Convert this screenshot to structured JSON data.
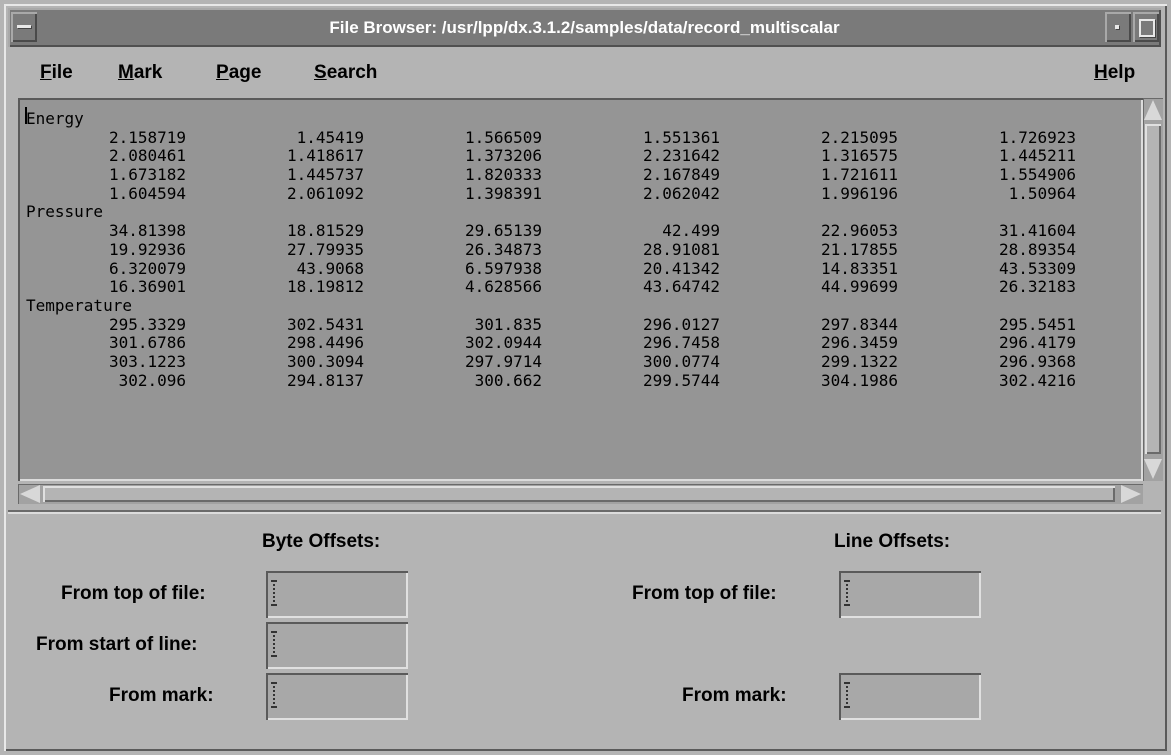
{
  "window": {
    "title": "File Browser: /usr/lpp/dx.3.1.2/samples/data/record_multiscalar"
  },
  "menu": {
    "file": "File",
    "mark": "Mark",
    "page": "Page",
    "search": "Search",
    "help": "Help"
  },
  "content": {
    "lines": [
      {
        "type": "header",
        "text": "Energy"
      },
      {
        "type": "row",
        "cells": [
          "2.158719",
          "1.45419",
          "1.566509",
          "1.551361",
          "2.215095",
          "1.726923"
        ]
      },
      {
        "type": "row",
        "cells": [
          "2.080461",
          "1.418617",
          "1.373206",
          "2.231642",
          "1.316575",
          "1.445211"
        ]
      },
      {
        "type": "row",
        "cells": [
          "1.673182",
          "1.445737",
          "1.820333",
          "2.167849",
          "1.721611",
          "1.554906"
        ]
      },
      {
        "type": "row",
        "cells": [
          "1.604594",
          "2.061092",
          "1.398391",
          "2.062042",
          "1.996196",
          "1.50964"
        ]
      },
      {
        "type": "header",
        "text": "Pressure"
      },
      {
        "type": "row",
        "cells": [
          "34.81398",
          "18.81529",
          "29.65139",
          "42.499",
          "22.96053",
          "31.41604"
        ]
      },
      {
        "type": "row",
        "cells": [
          "19.92936",
          "27.79935",
          "26.34873",
          "28.91081",
          "21.17855",
          "28.89354"
        ]
      },
      {
        "type": "row",
        "cells": [
          "6.320079",
          "43.9068",
          "6.597938",
          "20.41342",
          "14.83351",
          "43.53309"
        ]
      },
      {
        "type": "row",
        "cells": [
          "16.36901",
          "18.19812",
          "4.628566",
          "43.64742",
          "44.99699",
          "26.32183"
        ]
      },
      {
        "type": "header",
        "text": "Temperature"
      },
      {
        "type": "row",
        "cells": [
          "295.3329",
          "302.5431",
          "301.835",
          "296.0127",
          "297.8344",
          "295.5451"
        ]
      },
      {
        "type": "row",
        "cells": [
          "301.6786",
          "298.4496",
          "302.0944",
          "296.7458",
          "296.3459",
          "296.4179"
        ]
      },
      {
        "type": "row",
        "cells": [
          "303.1223",
          "300.3094",
          "297.9714",
          "300.0774",
          "299.1322",
          "296.9368"
        ]
      },
      {
        "type": "row",
        "cells": [
          "302.096",
          "294.8137",
          "300.662",
          "299.5744",
          "304.1986",
          "302.4216"
        ]
      }
    ]
  },
  "offsets": {
    "byte_title": "Byte Offsets:",
    "line_title": "Line Offsets:",
    "byte_from_top_label": "From top of file:",
    "byte_from_start_label": "From start of line:",
    "byte_from_mark_label": "From mark:",
    "line_from_top_label": "From top of file:",
    "line_from_mark_label": "From mark:",
    "byte_from_top_value": "",
    "byte_from_start_value": "",
    "byte_from_mark_value": "",
    "line_from_top_value": "",
    "line_from_mark_value": ""
  }
}
